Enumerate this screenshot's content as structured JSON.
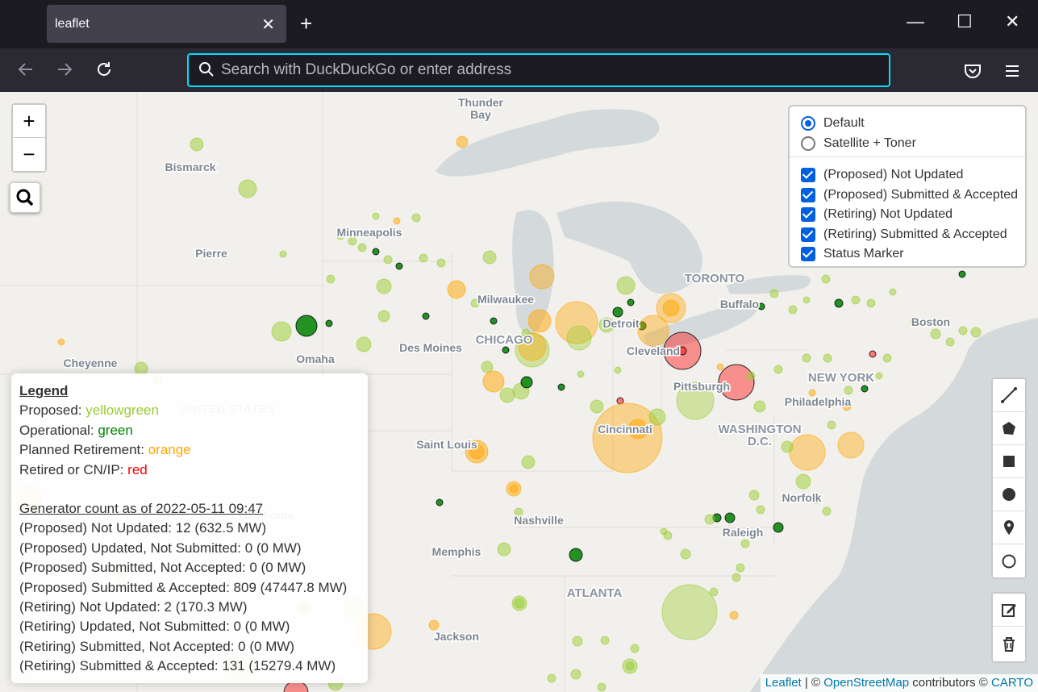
{
  "browser": {
    "tab_title": "leaflet",
    "url_placeholder": "Search with DuckDuckGo or enter address"
  },
  "map": {
    "city_labels": [
      {
        "name": "Thunder",
        "line2": "Bay"
      },
      {
        "name": "Bismarck"
      },
      {
        "name": "Minneapolis"
      },
      {
        "name": "Pierre"
      },
      {
        "name": "Milwaukee"
      },
      {
        "name": "CHICAGO"
      },
      {
        "name": "Des Moines"
      },
      {
        "name": "Omaha"
      },
      {
        "name": "Cheyenne"
      },
      {
        "name": "UNITED STATES"
      },
      {
        "name": "Detroit"
      },
      {
        "name": "TORONTO"
      },
      {
        "name": "Buffalo"
      },
      {
        "name": "Cleveland"
      },
      {
        "name": "Pittsburgh"
      },
      {
        "name": "Cincinnati"
      },
      {
        "name": "WASHINGTON",
        "line2": "D.C."
      },
      {
        "name": "Philadelphia"
      },
      {
        "name": "NEW YORK"
      },
      {
        "name": "Boston"
      },
      {
        "name": "Saint Louis"
      },
      {
        "name": "Nashville"
      },
      {
        "name": "Memphis"
      },
      {
        "name": "Norfolk"
      },
      {
        "name": "Raleigh"
      },
      {
        "name": "ATLANTA"
      },
      {
        "name": "Jackson"
      },
      {
        "name": "Oklahoma"
      }
    ],
    "colors": {
      "proposed": "#9acd32",
      "operational": "#008000",
      "planned_retirement": "#ffa500",
      "retired": "#ff0000"
    }
  },
  "zoom": {
    "in": "+",
    "out": "−"
  },
  "layers": {
    "base": [
      {
        "label": "Default",
        "selected": true
      },
      {
        "label": "Satellite + Toner",
        "selected": false
      }
    ],
    "overlays": [
      {
        "label": "(Proposed) Not Updated",
        "checked": true
      },
      {
        "label": "(Proposed) Submitted & Accepted",
        "checked": true
      },
      {
        "label": "(Retiring) Not Updated",
        "checked": true
      },
      {
        "label": "(Retiring) Submitted & Accepted",
        "checked": true
      },
      {
        "label": "Status Marker",
        "checked": true
      }
    ]
  },
  "legend": {
    "title": "Legend",
    "items": [
      {
        "label": "Proposed: ",
        "value": "yellowgreen",
        "color": "#9acd32"
      },
      {
        "label": "Operational: ",
        "value": "green",
        "color": "#008000"
      },
      {
        "label": "Planned Retirement: ",
        "value": "orange",
        "color": "#ffa500"
      },
      {
        "label": "Retired or CN/IP: ",
        "value": "red",
        "color": "#ff0000"
      }
    ],
    "count_title": "Generator count as of 2022-05-11 09:47",
    "counts": [
      "(Proposed) Not Updated: 12 (632.5 MW)",
      "(Proposed) Updated, Not Submitted: 0 (0 MW)",
      "(Proposed) Submitted, Not Accepted: 0 (0 MW)",
      "(Proposed) Submitted & Accepted: 809 (47447.8 MW)",
      "(Retiring) Not Updated: 2 (170.3 MW)",
      "(Retiring) Updated, Not Submitted: 0 (0 MW)",
      "(Retiring) Submitted, Not Accepted: 0 (0 MW)",
      "(Retiring) Submitted & Accepted: 131 (15279.4 MW)"
    ]
  },
  "attribution": {
    "leaflet": "Leaflet",
    "sep": " | © ",
    "osm": "OpenStreetMap",
    "contrib": " contributors © ",
    "carto": "CARTO"
  }
}
